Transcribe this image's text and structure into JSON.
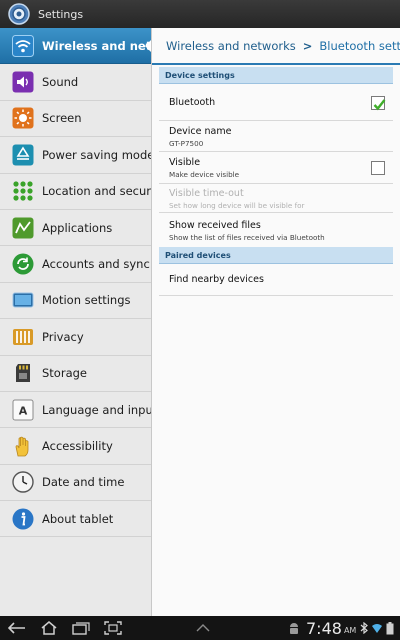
{
  "titlebar": {
    "title": "Settings",
    "icon": "settings-gear-icon"
  },
  "sidebar": {
    "items": [
      {
        "label": "Wireless and netw",
        "icon": "wifi-icon",
        "active": true
      },
      {
        "label": "Sound",
        "icon": "speaker-icon"
      },
      {
        "label": "Screen",
        "icon": "brightness-icon"
      },
      {
        "label": "Power saving mode",
        "icon": "recycle-icon"
      },
      {
        "label": "Location and securit",
        "icon": "location-grid-icon"
      },
      {
        "label": "Applications",
        "icon": "applications-icon"
      },
      {
        "label": "Accounts and sync",
        "icon": "sync-icon"
      },
      {
        "label": "Motion settings",
        "icon": "tablet-motion-icon"
      },
      {
        "label": "Privacy",
        "icon": "privacy-icon"
      },
      {
        "label": "Storage",
        "icon": "sd-card-icon"
      },
      {
        "label": "Language and input",
        "icon": "keyboard-letter-icon"
      },
      {
        "label": "Accessibility",
        "icon": "hand-icon"
      },
      {
        "label": "Date and time",
        "icon": "clock-icon"
      },
      {
        "label": "About tablet",
        "icon": "info-icon"
      }
    ]
  },
  "breadcrumb": {
    "parent": "Wireless and networks",
    "separator": ">",
    "current": "Bluetooth settings"
  },
  "sections": {
    "device_settings": "Device settings",
    "paired_devices": "Paired devices"
  },
  "settings": {
    "bluetooth": {
      "title": "Bluetooth",
      "checked": true
    },
    "device_name": {
      "title": "Device name",
      "value": "GT-P7500"
    },
    "visible": {
      "title": "Visible",
      "summary": "Make device visible",
      "checked": false
    },
    "visible_timeout": {
      "title": "Visible time-out",
      "summary": "Set how long device will be visible for",
      "enabled": false
    },
    "show_received": {
      "title": "Show received files",
      "summary": "Show the list of files received via Bluetooth"
    },
    "find_nearby": {
      "title": "Find nearby devices"
    }
  },
  "statusbar": {
    "time": "7:48",
    "ampm": "AM"
  },
  "colors": {
    "accent": "#1f6fa6",
    "section_bg": "#c8dff1",
    "sidebar_bg": "#e9e9e9",
    "check": "#3fae2a"
  }
}
